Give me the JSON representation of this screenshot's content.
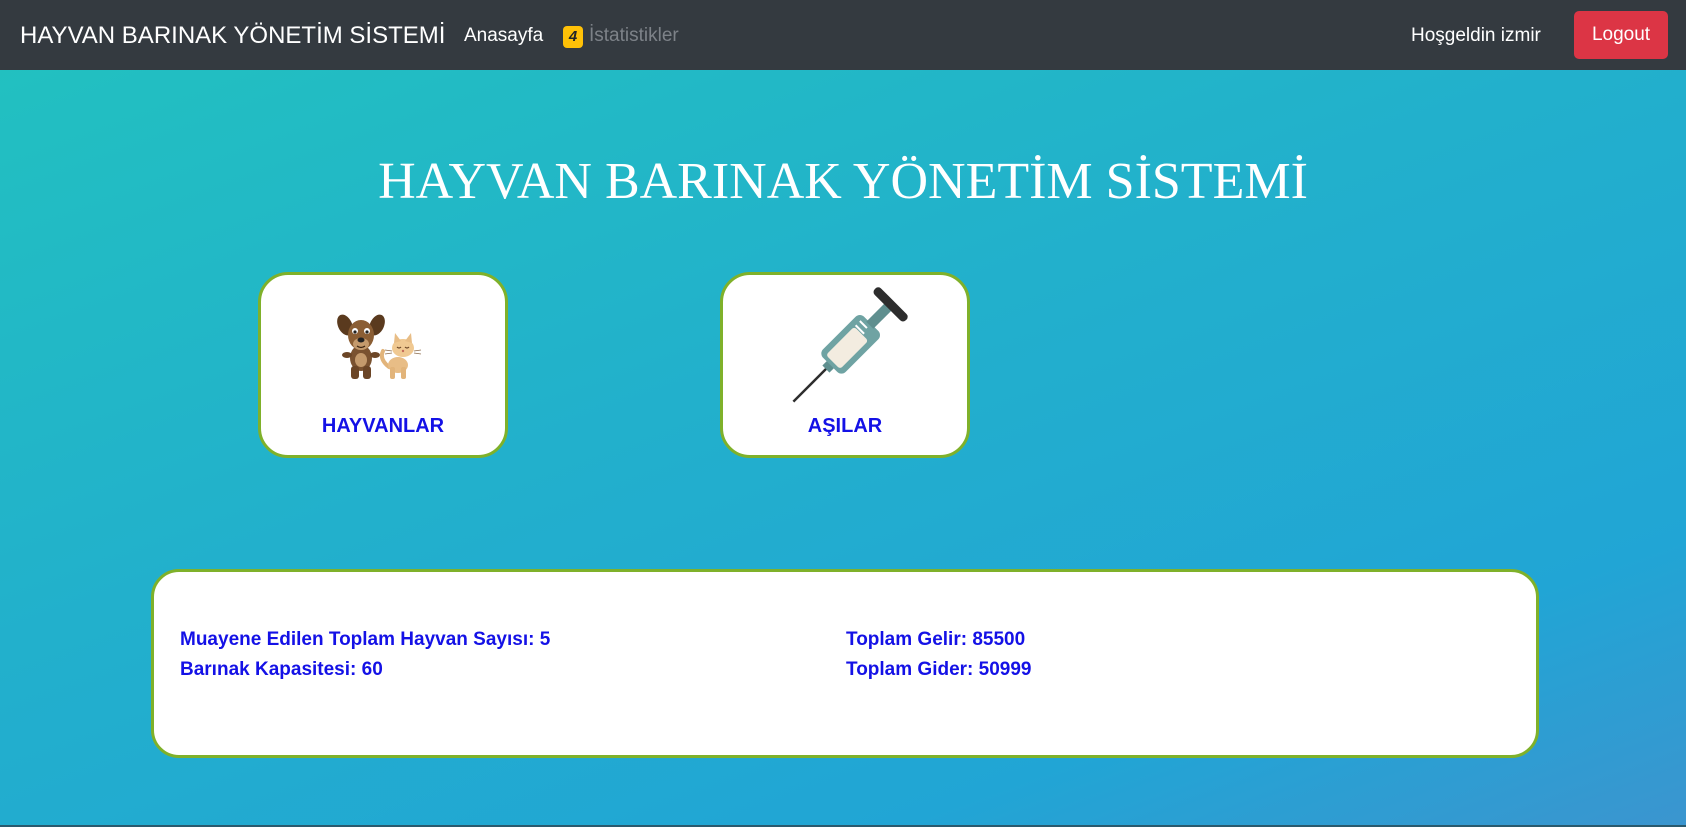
{
  "navbar": {
    "brand": "HAYVAN BARINAK YÖNETİM SİSTEMİ",
    "home_label": "Anasayfa",
    "badge_count": "4",
    "stats_label": "İstatistikler",
    "welcome_text": "Hoşgeldin izmir",
    "logout_label": "Logout"
  },
  "main": {
    "title": "HAYVAN BARINAK YÖNETİM SİSTEMİ",
    "tiles": [
      {
        "label": "HAYVANLAR",
        "icon": "dog-cat-icon"
      },
      {
        "label": "AŞILAR",
        "icon": "syringe-icon"
      }
    ]
  },
  "stats": {
    "examined_animals": "Muayene Edilen Toplam Hayvan Sayısı: 5",
    "capacity": "Barınak Kapasitesi: 60",
    "total_income": "Toplam Gelir: 85500",
    "total_expense": "Toplam Gider: 50999"
  },
  "colors": {
    "navbar_bg": "#343a40",
    "logout_bg": "#dc3545",
    "badge_bg": "#ffc107",
    "accent_text": "#1411e6",
    "card_border": "#7fb12a",
    "bg_gradient_start": "#22c2bf",
    "bg_gradient_end": "#3b95cf"
  }
}
